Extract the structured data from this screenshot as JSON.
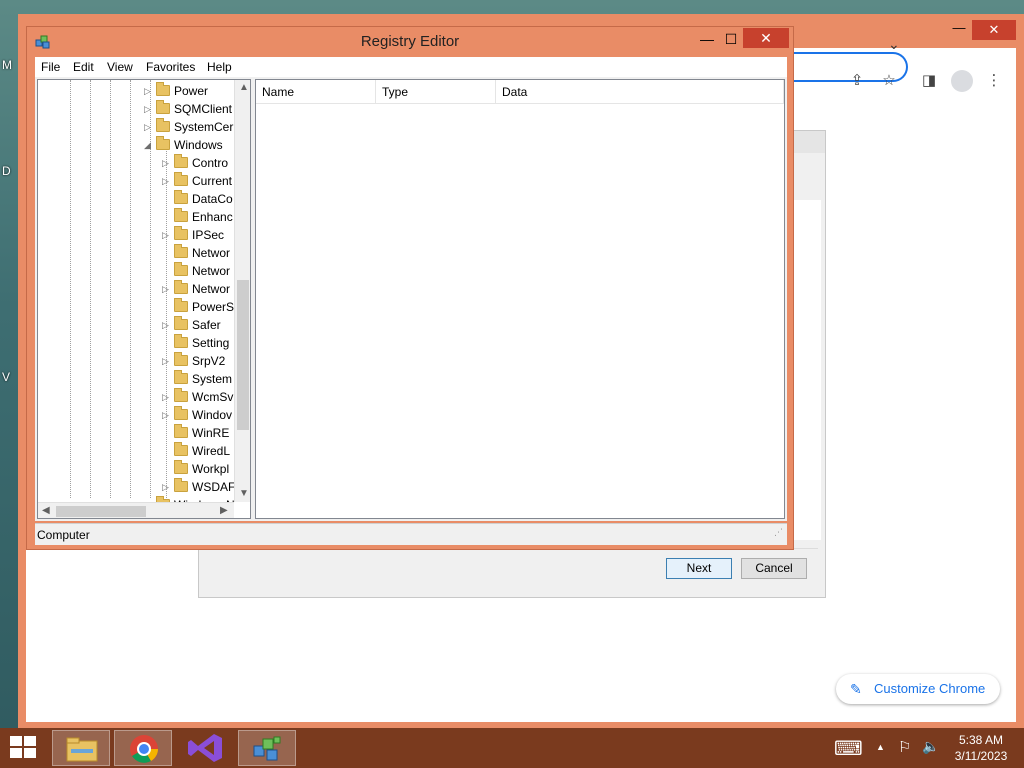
{
  "desktop": {
    "labels": [
      "M",
      "D",
      "V"
    ]
  },
  "chrome": {
    "minimize_glyph": "—",
    "maximize_glyph": "❐",
    "close_glyph": "✕",
    "dropdown_glyph": "⌄",
    "customize_label": "Customize Chrome",
    "toolbar_icons": [
      "share-icon",
      "bookmark-star-icon",
      "side-panel-icon",
      "profile-icon",
      "menu-kebab-icon"
    ]
  },
  "wizard": {
    "close_glyph": "✕",
    "next_label": "Next",
    "cancel_label": "Cancel"
  },
  "regedit": {
    "title": "Registry Editor",
    "minimize_glyph": "—",
    "maximize_glyph": "☐",
    "close_glyph": "✕",
    "menu": [
      "File",
      "Edit",
      "View",
      "Favorites",
      "Help"
    ],
    "tree": [
      {
        "label": "Power",
        "expander": "▷",
        "level": 0
      },
      {
        "label": "SQMClient",
        "expander": "▷",
        "level": 0
      },
      {
        "label": "SystemCer",
        "expander": "▷",
        "level": 0
      },
      {
        "label": "Windows",
        "expander": "◢",
        "level": 0
      },
      {
        "label": "Contro",
        "expander": "▷",
        "level": 1
      },
      {
        "label": "Current",
        "expander": "▷",
        "level": 1
      },
      {
        "label": "DataCo",
        "expander": "",
        "level": 1
      },
      {
        "label": "Enhanc",
        "expander": "",
        "level": 1
      },
      {
        "label": "IPSec",
        "expander": "▷",
        "level": 1
      },
      {
        "label": "Networ",
        "expander": "",
        "level": 1
      },
      {
        "label": "Networ",
        "expander": "",
        "level": 1
      },
      {
        "label": "Networ",
        "expander": "▷",
        "level": 1
      },
      {
        "label": "PowerS",
        "expander": "",
        "level": 1
      },
      {
        "label": "Safer",
        "expander": "▷",
        "level": 1
      },
      {
        "label": "Setting",
        "expander": "",
        "level": 1
      },
      {
        "label": "SrpV2",
        "expander": "▷",
        "level": 1
      },
      {
        "label": "System",
        "expander": "",
        "level": 1
      },
      {
        "label": "WcmSv",
        "expander": "▷",
        "level": 1
      },
      {
        "label": "Windov",
        "expander": "▷",
        "level": 1
      },
      {
        "label": "WinRE",
        "expander": "",
        "level": 1
      },
      {
        "label": "WiredL",
        "expander": "",
        "level": 1
      },
      {
        "label": "Workpl",
        "expander": "",
        "level": 1
      },
      {
        "label": "WSDAF",
        "expander": "▷",
        "level": 1
      },
      {
        "label": "Windows N",
        "expander": "",
        "level": 0
      }
    ],
    "columns": [
      "Name",
      "Type",
      "Data"
    ],
    "status": "Computer"
  },
  "taskbar": {
    "apps": [
      "file-explorer-icon",
      "chrome-icon",
      "visual-studio-icon",
      "regedit-icon"
    ],
    "time": "5:38 AM",
    "date": "3/11/2023",
    "tray_icons": [
      "keyboard-icon",
      "show-hidden-icons",
      "network-icon",
      "volume-icon"
    ],
    "tray_glyphs": {
      "keyboard": "⌨",
      "up": "▲",
      "network": "⚐",
      "volume": "🔈"
    }
  },
  "colors": {
    "window_frame": "#e98c66",
    "close_red": "#c7412d",
    "taskbar": "#7a3a1e",
    "accent_blue": "#1a73e8",
    "folder_yellow": "#e8c262"
  }
}
